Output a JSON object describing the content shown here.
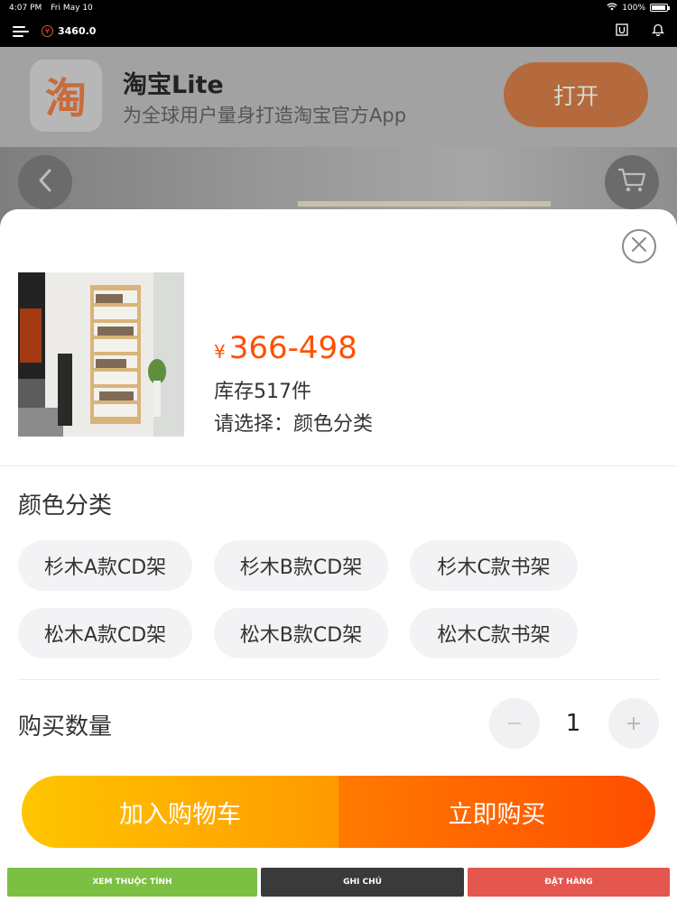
{
  "status_bar": {
    "time": "4:07 PM",
    "date": "Fri May 10",
    "battery": "100%"
  },
  "app_bar": {
    "balance": "3460.0",
    "coin_symbol": "¥"
  },
  "banner": {
    "logo_char": "淘",
    "title": "淘宝Lite",
    "subtitle": "为全球用户量身打造淘宝官方App",
    "open_label": "打开"
  },
  "product": {
    "currency": "¥",
    "price_range": "366-498",
    "stock": "库存517件",
    "select_hint": "请选择：颜色分类"
  },
  "options": {
    "title": "颜色分类",
    "items": [
      "杉木A款CD架",
      "杉木B款CD架",
      "杉木C款书架",
      "松木A款CD架",
      "松木B款CD架",
      "松木C款书架"
    ]
  },
  "quantity": {
    "label": "购买数量",
    "value": "1",
    "minus": "−",
    "plus": "+"
  },
  "actions": {
    "add_to_cart": "加入购物车",
    "buy_now": "立即购买"
  },
  "toolbar": {
    "attributes": {
      "label": "XEM THUỘC TÍNH",
      "color": "#7cc043"
    },
    "note": {
      "label": "GHI CHÚ",
      "color": "#3a3a3a"
    },
    "order": {
      "label": "ĐẶT HÀNG",
      "color": "#e4574f"
    }
  },
  "colors": {
    "price": "#ff5000",
    "cart_gradient": [
      "#ffc500",
      "#ff9a00"
    ],
    "buy_gradient": [
      "#ff7a00",
      "#ff4e00"
    ]
  }
}
